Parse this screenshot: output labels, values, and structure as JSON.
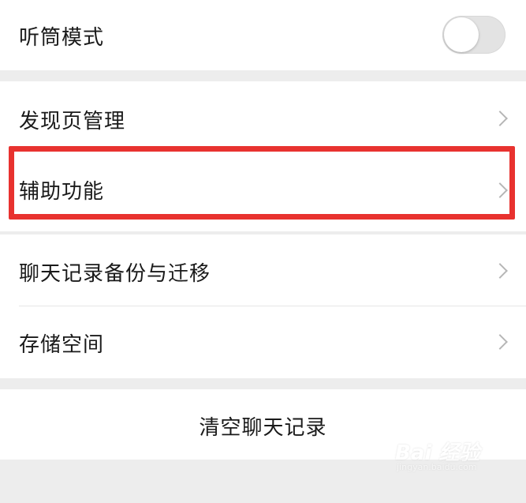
{
  "settings": {
    "earpiece_mode": {
      "label": "听筒模式",
      "toggle_on": false
    },
    "items": [
      {
        "label": "发现页管理",
        "icon": "chevron-right-icon"
      },
      {
        "label": "辅助功能",
        "icon": "chevron-right-icon",
        "highlighted": true
      },
      {
        "label": "聊天记录备份与迁移",
        "icon": "chevron-right-icon"
      },
      {
        "label": "存储空间",
        "icon": "chevron-right-icon"
      }
    ],
    "clear_history_label": "清空聊天记录"
  },
  "highlight_color": "#e8322f",
  "watermark": {
    "logo_text": "Bai 经验",
    "sub_text": "jingyan.baidu.com"
  }
}
